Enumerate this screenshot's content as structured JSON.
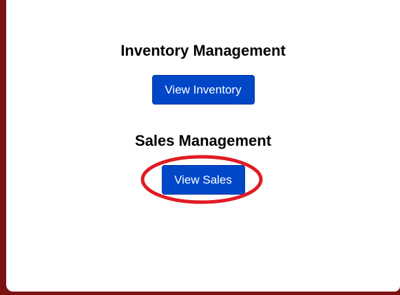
{
  "inventory": {
    "title": "Inventory Management",
    "button_label": "View Inventory"
  },
  "sales": {
    "title": "Sales Management",
    "button_label": "View Sales"
  },
  "colors": {
    "page_border": "#7a1212",
    "card_background": "#ffffff",
    "button_background": "#0047c8",
    "highlight_ring": "#e01b24"
  }
}
